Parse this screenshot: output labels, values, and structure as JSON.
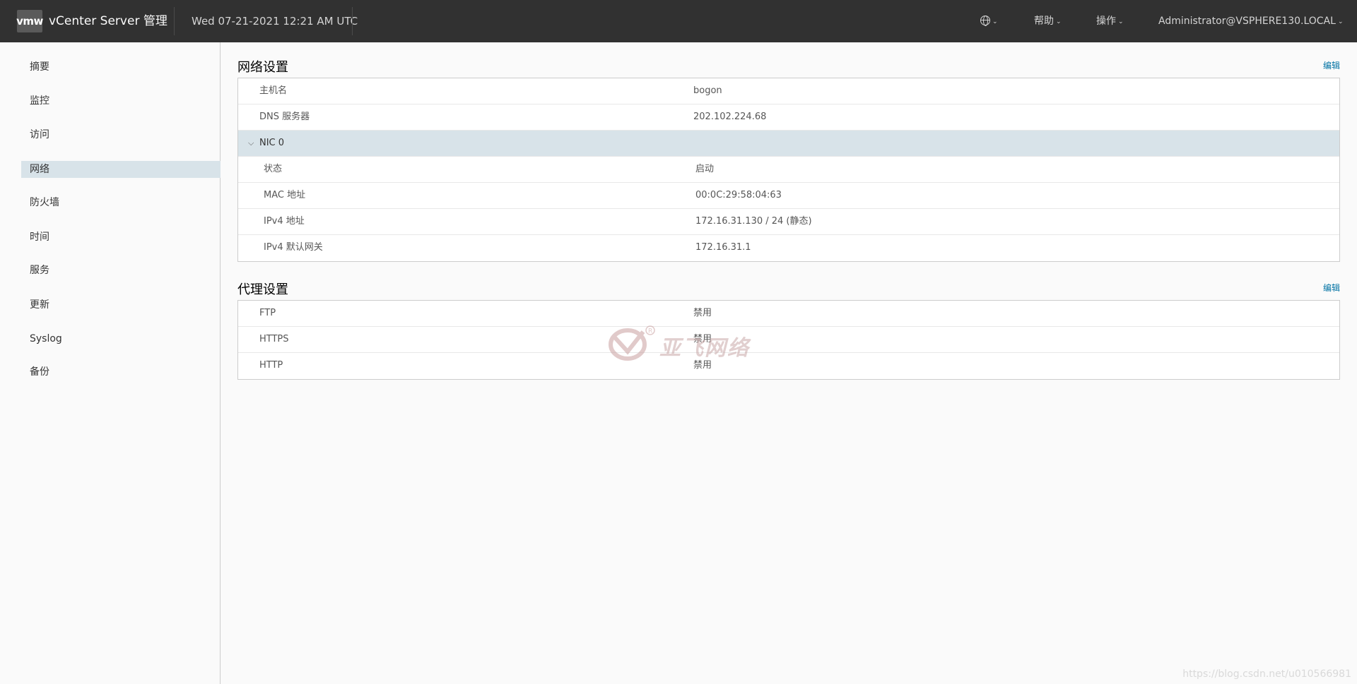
{
  "header": {
    "logo": "vmw",
    "title": "vCenter Server 管理",
    "datetime": "Wed 07-21-2021 12:21 AM UTC",
    "language_icon": "globe-icon",
    "help_label": "帮助",
    "actions_label": "操作",
    "user_label": "Administrator@VSPHERE130.LOCAL"
  },
  "sidebar": {
    "items": [
      {
        "label": "摘要"
      },
      {
        "label": "监控"
      },
      {
        "label": "访问"
      },
      {
        "label": "网络",
        "active": true
      },
      {
        "label": "防火墙"
      },
      {
        "label": "时间"
      },
      {
        "label": "服务"
      },
      {
        "label": "更新"
      },
      {
        "label": "Syslog"
      },
      {
        "label": "备份"
      }
    ]
  },
  "network": {
    "title": "网络设置",
    "edit_label": "编辑",
    "hostname_label": "主机名",
    "hostname_value": "bogon",
    "dns_label": "DNS 服务器",
    "dns_value": "202.102.224.68",
    "nic": {
      "label": "NIC 0",
      "status_label": "状态",
      "status_value": "启动",
      "mac_label": "MAC 地址",
      "mac_value": "00:0C:29:58:04:63",
      "ipv4_label": "IPv4 地址",
      "ipv4_value": "172.16.31.130 / 24 (静态)",
      "gateway_label": "IPv4 默认网关",
      "gateway_value": "172.16.31.1"
    }
  },
  "proxy": {
    "title": "代理设置",
    "edit_label": "编辑",
    "rows": [
      {
        "label": "FTP",
        "value": "禁用"
      },
      {
        "label": "HTTPS",
        "value": "禁用"
      },
      {
        "label": "HTTP",
        "value": "禁用"
      }
    ]
  },
  "watermark": {
    "text": "亚飞网络"
  },
  "footer_watermark": "https://blog.csdn.net/u010566981",
  "colors": {
    "header_bg": "#313131",
    "selected_bg": "#d8e3e9",
    "link": "#0072a3"
  }
}
